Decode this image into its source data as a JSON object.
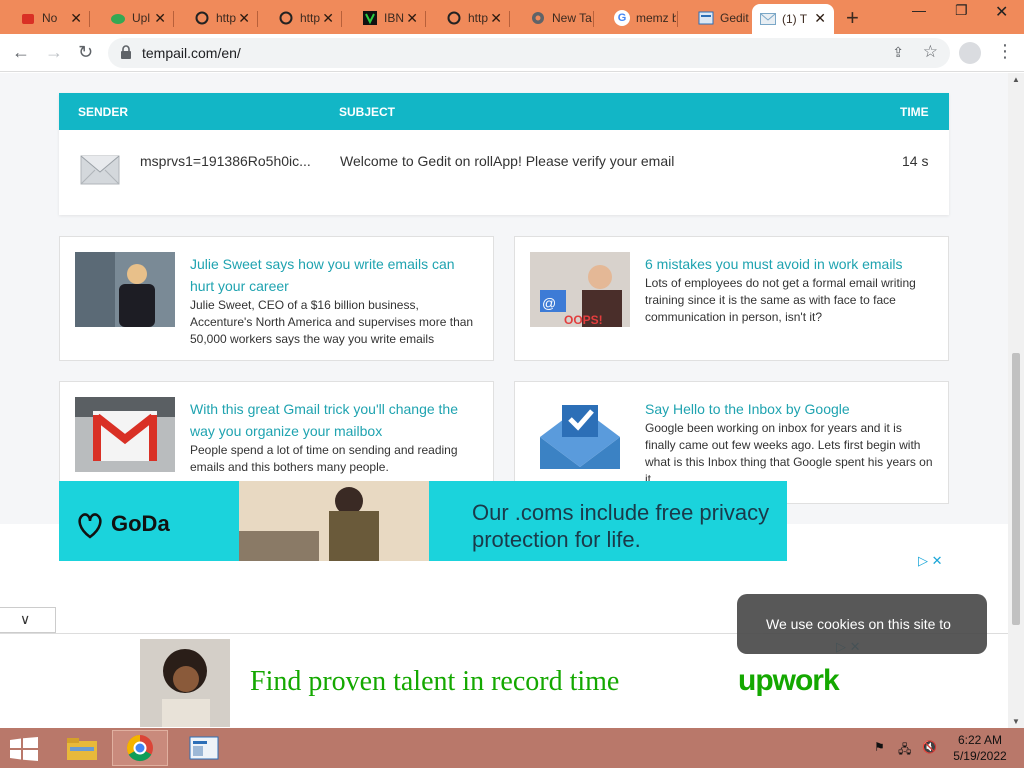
{
  "browser": {
    "tabs": [
      {
        "title": "No",
        "icon": "red-app-icon",
        "color": "#d93025"
      },
      {
        "title": "Upl",
        "icon": "cloud-upload-icon",
        "color": "#1e8e3e"
      },
      {
        "title": "http",
        "icon": "o-icon",
        "color": "#222222"
      },
      {
        "title": "http",
        "icon": "o-icon",
        "color": "#222222"
      },
      {
        "title": "IBN",
        "icon": "v-icon",
        "color": "#2ecc40"
      },
      {
        "title": "http",
        "icon": "o-icon",
        "color": "#222222"
      },
      {
        "title": "New Tal",
        "icon": "chrome-icon",
        "color": "#5f6368"
      },
      {
        "title": "memz b",
        "icon": "google-icon",
        "color": "#4285f4"
      },
      {
        "title": "Gedit O",
        "icon": "gedit-icon",
        "color": "#2c6fb7"
      },
      {
        "title": "(1) T",
        "icon": "mail-icon",
        "color": "#7aa7c7"
      }
    ],
    "url": "tempail.com/en/"
  },
  "mail": {
    "headers": {
      "sender": "SENDER",
      "subject": "SUBJECT",
      "time": "TIME"
    },
    "rows": [
      {
        "sender": "msprvs1=191386Ro5h0ic...",
        "subject": "Welcome to Gedit on rollApp! Please verify your email",
        "time": "14 s"
      }
    ]
  },
  "articles": [
    {
      "title": "Julie Sweet says how you write emails can hurt your career",
      "desc": "Julie Sweet, CEO of a $16 billion business, Accenture's North America and supervises more than 50,000 workers says the way you write emails"
    },
    {
      "title": "6 mistakes you must avoid in work emails",
      "desc": "Lots of employees do not get a formal email writing training since it is the same as with face to face communication in person, isn't it?"
    },
    {
      "title": "With this great Gmail trick you'll change the way you organize your mailbox",
      "desc": "People spend a lot of time on sending and reading emails and this bothers many people."
    },
    {
      "title": "Say Hello to the Inbox by Google",
      "desc": "Google been working on inbox for years and it is finally came out few weeks ago. Lets first begin with what is this Inbox thing that Google spent his years on it."
    }
  ],
  "ads": {
    "godaddy": {
      "brand": "GoDa",
      "copy": "Our .coms include free privacy protection for life."
    },
    "upwork": {
      "copy": "Find proven talent in record time",
      "logo": "upwork"
    }
  },
  "cookie": {
    "text": "We use cookies on this site to"
  },
  "taskbar": {
    "time": "6:22 AM",
    "date": "5/19/2022"
  },
  "colors": {
    "accent": "#12b6c6",
    "link": "#1fa3b0",
    "tabstrip": "#f08a5a",
    "taskbar": "#b9786a"
  }
}
